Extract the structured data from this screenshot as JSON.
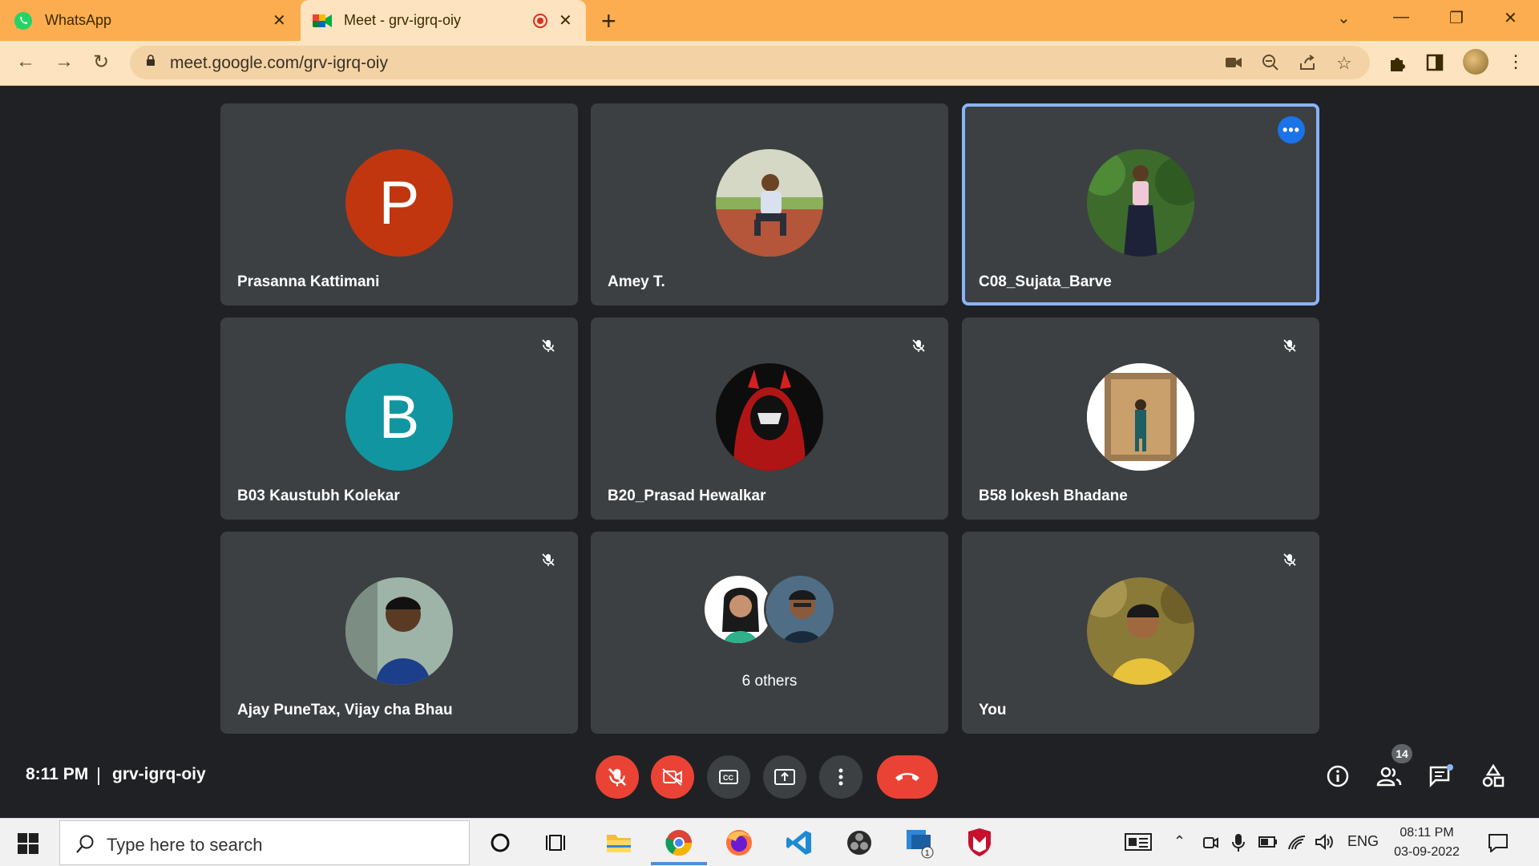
{
  "browser": {
    "tabs": [
      {
        "label": "WhatsApp",
        "icon": "whatsapp-icon"
      },
      {
        "label": "Meet - grv-igrq-oiy",
        "icon": "google-meet-icon",
        "recording": true
      }
    ],
    "url": "meet.google.com/grv-igrq-oiy"
  },
  "tiles": [
    {
      "name": "Prasanna Kattimani",
      "avatar_letter": "P",
      "avatar_color": "#c1360f"
    },
    {
      "name": "Amey T.",
      "avatar": "photo"
    },
    {
      "name": "C08_Sujata_Barve",
      "avatar": "photo",
      "active": true
    },
    {
      "name": "B03 Kaustubh Kolekar",
      "avatar_letter": "B",
      "avatar_color": "#1196a1",
      "muted": true
    },
    {
      "name": "B20_Prasad Hewalkar",
      "avatar": "photo",
      "muted": true
    },
    {
      "name": "B58 lokesh Bhadane",
      "avatar": "photo",
      "muted": true
    },
    {
      "name": "Ajay PuneTax, Vijay cha Bhau",
      "avatar": "photo",
      "muted": true
    },
    {
      "name": "6 others"
    },
    {
      "name": "You",
      "avatar": "photo",
      "muted": true
    }
  ],
  "meeting": {
    "time": "8:11 PM",
    "code": "grv-igrq-oiy",
    "participant_count": "14"
  },
  "taskbar": {
    "search_placeholder": "Type here to search",
    "language": "ENG",
    "time": "08:11 PM",
    "date": "03-09-2022",
    "teams_badge": "1"
  },
  "colors": {
    "tab_bar": "#fbad50",
    "toolbar": "#fde3bf",
    "meet_bg": "#202124",
    "tile_bg": "#3c4043",
    "danger": "#ea4335",
    "active_outline": "#8ab4f8"
  }
}
